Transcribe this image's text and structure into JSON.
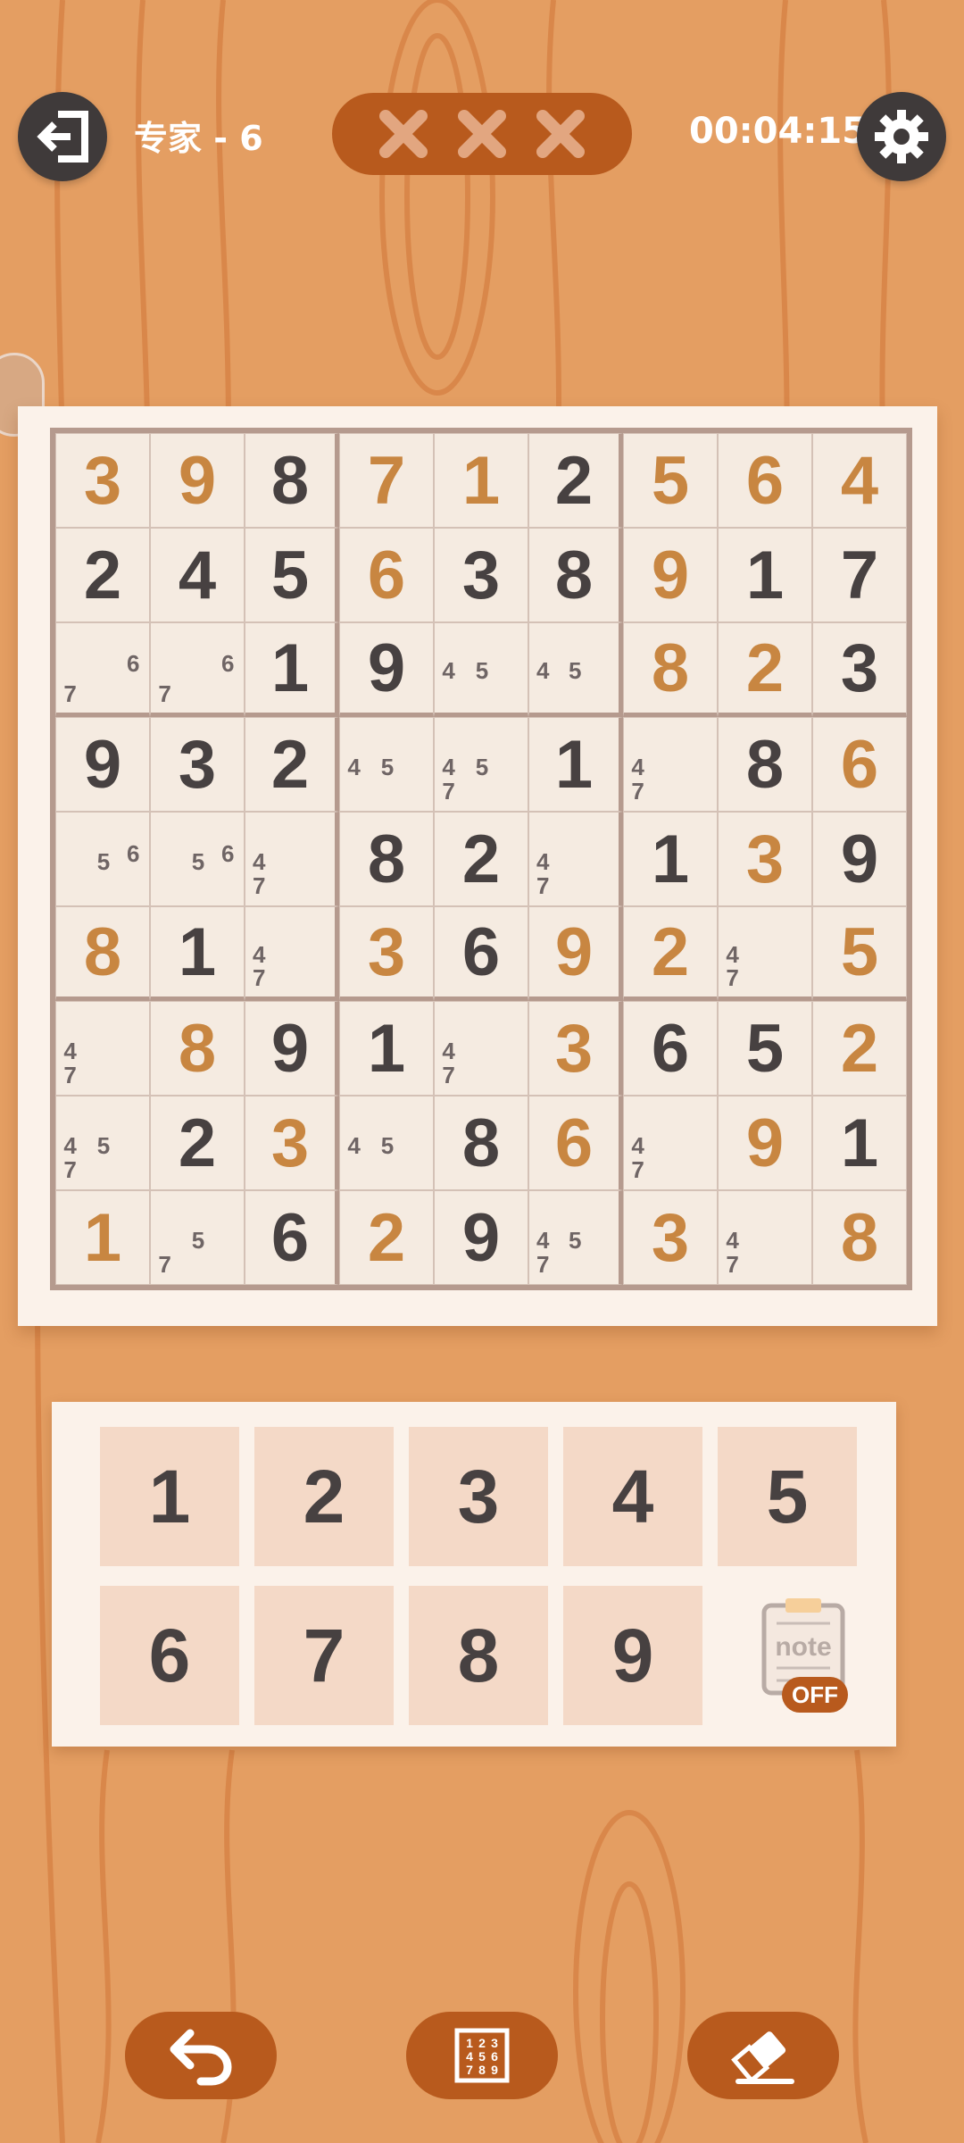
{
  "header": {
    "level_label": "专家 - 6",
    "timer": "00:04:15",
    "mistakes": [
      "x",
      "x",
      "x"
    ]
  },
  "board": {
    "rows": [
      [
        "3",
        "9",
        "8",
        "7",
        "1",
        "2",
        "5",
        "6",
        "4"
      ],
      [
        "2",
        "4",
        "5",
        "6",
        "3",
        "8",
        "9",
        "1",
        "7"
      ],
      [
        "",
        "",
        "1",
        "9",
        "",
        "",
        "8",
        "2",
        "3"
      ],
      [
        "9",
        "3",
        "2",
        "",
        "",
        "1",
        "",
        "8",
        "6"
      ],
      [
        "",
        "",
        "",
        "8",
        "2",
        "",
        "1",
        "3",
        "9"
      ],
      [
        "8",
        "1",
        "",
        "3",
        "6",
        "9",
        "2",
        "",
        "5"
      ],
      [
        "",
        "8",
        "9",
        "1",
        "",
        "3",
        "6",
        "5",
        "2"
      ],
      [
        "",
        "2",
        "3",
        "",
        "8",
        "6",
        "",
        "9",
        "1"
      ],
      [
        "1",
        "",
        "6",
        "2",
        "9",
        "",
        "3",
        "",
        "8"
      ]
    ],
    "entered": [
      [
        1,
        1,
        0,
        1,
        1,
        0,
        1,
        1,
        1
      ],
      [
        0,
        0,
        0,
        1,
        0,
        0,
        1,
        0,
        0
      ],
      [
        0,
        0,
        0,
        0,
        0,
        0,
        1,
        1,
        0
      ],
      [
        0,
        0,
        0,
        0,
        0,
        0,
        0,
        0,
        1
      ],
      [
        0,
        0,
        0,
        0,
        0,
        0,
        0,
        1,
        0
      ],
      [
        1,
        0,
        0,
        1,
        0,
        1,
        1,
        0,
        1
      ],
      [
        0,
        1,
        0,
        0,
        0,
        1,
        0,
        0,
        1
      ],
      [
        0,
        0,
        1,
        0,
        0,
        1,
        0,
        1,
        0
      ],
      [
        1,
        0,
        0,
        1,
        0,
        0,
        1,
        0,
        1
      ]
    ],
    "notes": [
      [
        [],
        [],
        [],
        [],
        [],
        [],
        [],
        [],
        []
      ],
      [
        [],
        [],
        [],
        [],
        [],
        [],
        [],
        [],
        []
      ],
      [
        [
          "6",
          "7"
        ],
        [
          "6",
          "7"
        ],
        [],
        [],
        [
          "4",
          "5"
        ],
        [
          "4",
          "5"
        ],
        [],
        [],
        []
      ],
      [
        [],
        [],
        [],
        [
          "4",
          "5"
        ],
        [
          "4",
          "5",
          "7"
        ],
        [],
        [
          "4",
          "7"
        ],
        [],
        []
      ],
      [
        [
          "5",
          "6"
        ],
        [
          "5",
          "6"
        ],
        [
          "4",
          "7"
        ],
        [],
        [],
        [
          "4",
          "7"
        ],
        [],
        [],
        []
      ],
      [
        [],
        [],
        [
          "4",
          "7"
        ],
        [],
        [],
        [],
        [],
        [
          "4",
          "7"
        ],
        []
      ],
      [
        [
          "4",
          "7"
        ],
        [],
        [],
        [],
        [
          "4",
          "7"
        ],
        [],
        [],
        [],
        []
      ],
      [
        [
          "4",
          "5",
          "7"
        ],
        [],
        [],
        [
          "4",
          "5"
        ],
        [],
        [],
        [
          "4",
          "7"
        ],
        [],
        []
      ],
      [
        [],
        [
          "5",
          "7"
        ],
        [],
        [],
        [],
        [
          "4",
          "5",
          "7"
        ],
        [],
        [
          "4",
          "7"
        ],
        []
      ]
    ]
  },
  "keypad": {
    "keys": [
      "1",
      "2",
      "3",
      "4",
      "5",
      "6",
      "7",
      "8",
      "9"
    ],
    "note_label": "note",
    "note_state": "OFF"
  },
  "colors": {
    "background": "#e49e62",
    "accent": "#b85a1d",
    "given_digit": "#474141",
    "entered_digit": "#c88641"
  },
  "icons": {
    "exit": "exit-icon",
    "settings": "gear-icon",
    "undo": "undo-icon",
    "autonote": "number-grid-icon",
    "erase": "eraser-icon"
  }
}
